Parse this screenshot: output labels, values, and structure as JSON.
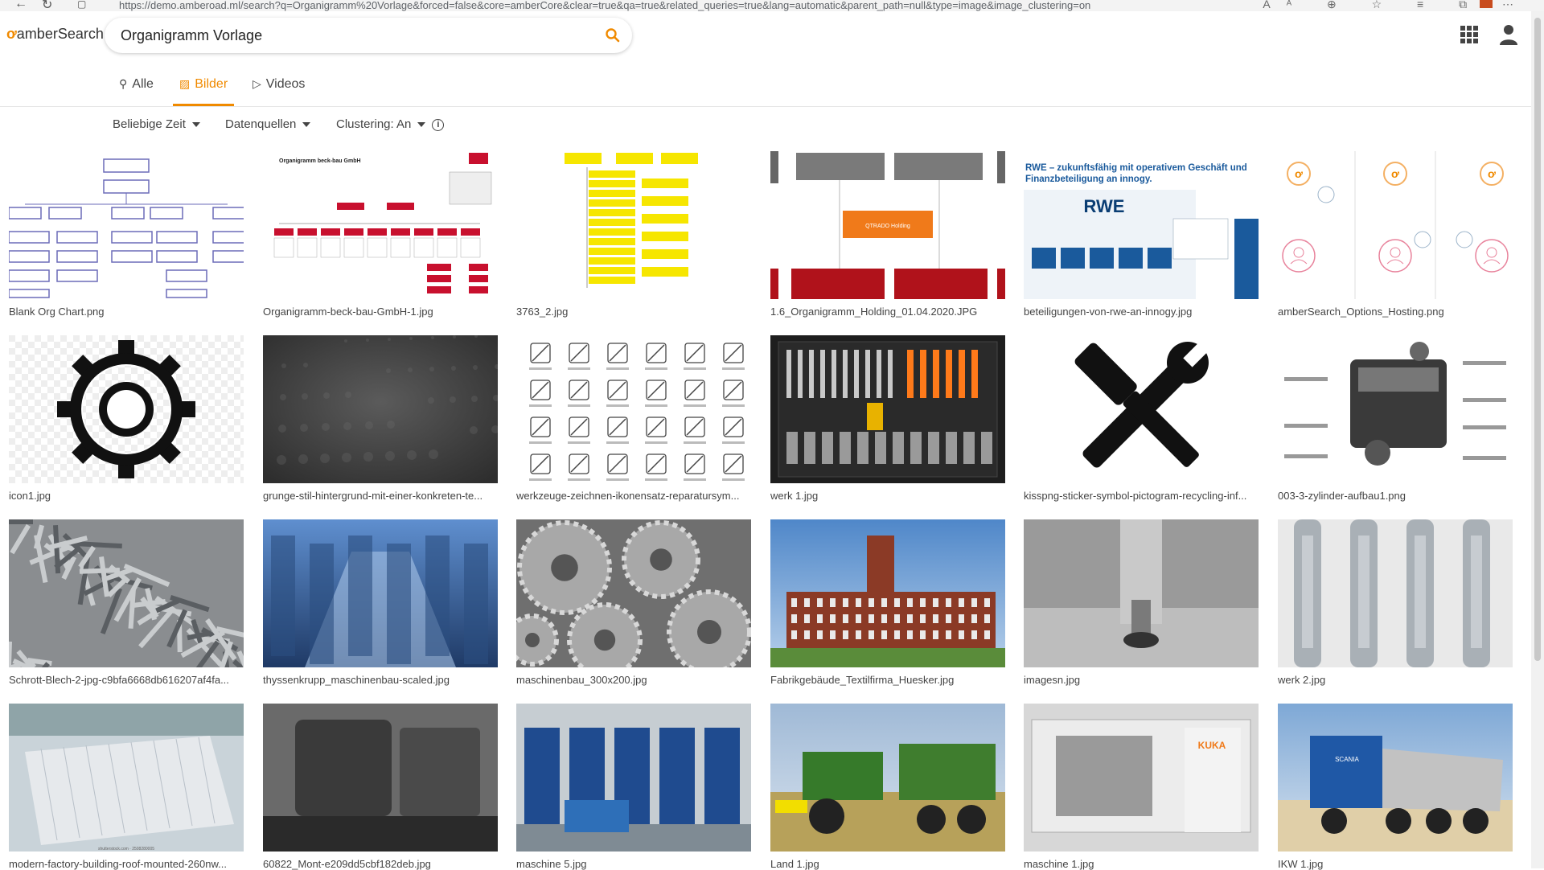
{
  "browser": {
    "url": "https://demo.amberoad.ml/search?q=Organigramm%20Vorlage&forced=false&core=amberCore&clear=true&qa=true&related_queries=true&lang=automatic&parent_path=null&type=image&image_clustering=on"
  },
  "header": {
    "logo_text": "amberSearch",
    "search_value": "Organigramm Vorlage"
  },
  "tabs": [
    {
      "label": "Alle",
      "icon": "search-icon",
      "active": false
    },
    {
      "label": "Bilder",
      "icon": "image-icon",
      "active": true
    },
    {
      "label": "Videos",
      "icon": "video-icon",
      "active": false
    }
  ],
  "filters": {
    "time": "Beliebige Zeit",
    "sources": "Datenquellen",
    "clustering": "Clustering: An"
  },
  "results": [
    {
      "caption": "Blank Org Chart.png",
      "kind": "orgchart-blank"
    },
    {
      "caption": "Organigramm-beck-bau-GmbH-1.jpg",
      "kind": "orgchart-red"
    },
    {
      "caption": "3763_2.jpg",
      "kind": "orgchart-yellow"
    },
    {
      "caption": "1.6_Organigramm_Holding_01.04.2020.JPG",
      "kind": "orgchart-holding"
    },
    {
      "caption": "beteiligungen-von-rwe-an-innogy.jpg",
      "kind": "rwe"
    },
    {
      "caption": "amberSearch_Options_Hosting.png",
      "kind": "hosting"
    },
    {
      "caption": "icon1.jpg",
      "kind": "gear"
    },
    {
      "caption": "grunge-stil-hintergrund-mit-einer-konkreten-te...",
      "kind": "grunge"
    },
    {
      "caption": "werkzeuge-zeichnen-ikonensatz-reparatursym...",
      "kind": "toolicons"
    },
    {
      "caption": "werk 1.jpg",
      "kind": "toolcase"
    },
    {
      "caption": "kisspng-sticker-symbol-pictogram-recycling-inf...",
      "kind": "wrench-screwdriver"
    },
    {
      "caption": "003-3-zylinder-aufbau1.png",
      "kind": "engine"
    },
    {
      "caption": "Schrott-Blech-2-jpg-c9bfa6668db616207af4fa...",
      "kind": "scrap"
    },
    {
      "caption": "thyssenkrupp_maschinenbau-scaled.jpg",
      "kind": "factory-blue"
    },
    {
      "caption": "maschinenbau_300x200.jpg",
      "kind": "gears-photo"
    },
    {
      "caption": "Fabrikgebäude_Textilfirma_Huesker.jpg",
      "kind": "brick"
    },
    {
      "caption": "imagesn.jpg",
      "kind": "drill"
    },
    {
      "caption": "werk 2.jpg",
      "kind": "spanners"
    },
    {
      "caption": "modern-factory-building-roof-mounted-260nw...",
      "kind": "modern-factory"
    },
    {
      "caption": "60822_Mont-e209dd5cbf182deb.jpg",
      "kind": "vintage"
    },
    {
      "caption": "maschine 5.jpg",
      "kind": "warehouse"
    },
    {
      "caption": "Land 1.jpg",
      "kind": "tractor"
    },
    {
      "caption": "maschine 1.jpg",
      "kind": "kuka"
    },
    {
      "caption": "IKW 1.jpg",
      "kind": "truck"
    }
  ],
  "thumb_text": {
    "rwe_title": "RWE – zukunftsfähig mit operativem Geschäft und Finanzbeteiligung an innogy.",
    "rwe_logo": "RWE",
    "beck_title": "Organigramm beck-bau GmbH",
    "holding_center": "QTRADO Holding",
    "kuka": "KUKA",
    "scania": "SCANIA",
    "shutterstock": "shutterstock.com · 2508280005"
  },
  "colors": {
    "accent": "#f08a00",
    "orgchart_line": "#6b6bb8",
    "holding_red": "#b0121b",
    "holding_orange": "#f07a1a",
    "rwe_blue": "#1a5a9c"
  }
}
